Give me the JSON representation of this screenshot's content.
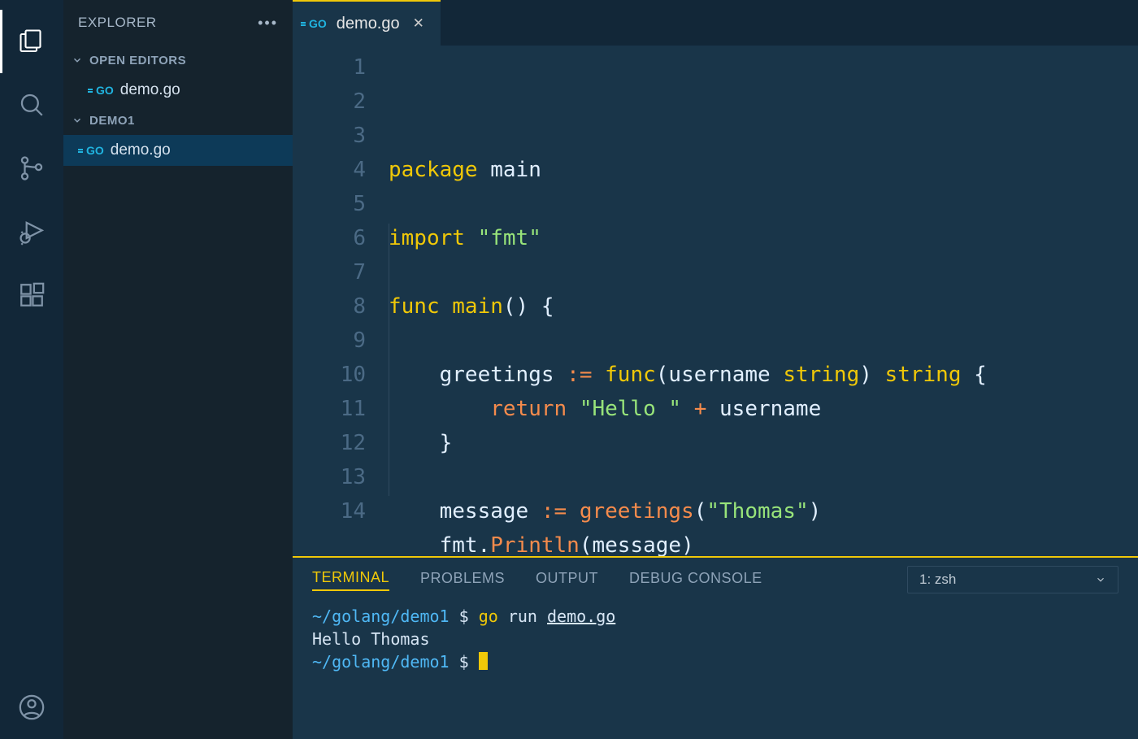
{
  "sidebar": {
    "title": "EXPLORER",
    "sections": {
      "open_editors_label": "OPEN EDITORS",
      "project_label": "DEMO1"
    },
    "open_editors": [
      {
        "name": "demo.go",
        "icon": "go"
      }
    ],
    "project_files": [
      {
        "name": "demo.go",
        "icon": "go",
        "selected": true
      }
    ]
  },
  "tabs": [
    {
      "name": "demo.go",
      "icon": "go",
      "active": true
    }
  ],
  "editor": {
    "line_numbers": [
      "1",
      "2",
      "3",
      "4",
      "5",
      "6",
      "7",
      "8",
      "9",
      "10",
      "11",
      "12",
      "13",
      "14"
    ],
    "code": [
      [
        {
          "t": "package",
          "c": "tk-kw"
        },
        {
          "t": " ",
          "c": ""
        },
        {
          "t": "main",
          "c": "tk-ident"
        }
      ],
      [],
      [
        {
          "t": "import",
          "c": "tk-kw"
        },
        {
          "t": " ",
          "c": ""
        },
        {
          "t": "\"fmt\"",
          "c": "tk-str"
        }
      ],
      [],
      [
        {
          "t": "func",
          "c": "tk-kw"
        },
        {
          "t": " ",
          "c": ""
        },
        {
          "t": "main",
          "c": "tk-func"
        },
        {
          "t": "() {",
          "c": "tk-paren"
        }
      ],
      [],
      [
        {
          "t": "    ",
          "c": ""
        },
        {
          "t": "greetings",
          "c": "tk-ident"
        },
        {
          "t": " ",
          "c": ""
        },
        {
          "t": ":=",
          "c": "tk-op"
        },
        {
          "t": " ",
          "c": ""
        },
        {
          "t": "func",
          "c": "tk-kw"
        },
        {
          "t": "(",
          "c": "tk-paren"
        },
        {
          "t": "username",
          "c": "tk-ident"
        },
        {
          "t": " ",
          "c": ""
        },
        {
          "t": "string",
          "c": "tk-type"
        },
        {
          "t": ") ",
          "c": "tk-paren"
        },
        {
          "t": "string",
          "c": "tk-type"
        },
        {
          "t": " {",
          "c": "tk-paren"
        }
      ],
      [
        {
          "t": "        ",
          "c": ""
        },
        {
          "t": "return",
          "c": "tk-return"
        },
        {
          "t": " ",
          "c": ""
        },
        {
          "t": "\"Hello \"",
          "c": "tk-str"
        },
        {
          "t": " ",
          "c": ""
        },
        {
          "t": "+",
          "c": "tk-op"
        },
        {
          "t": " ",
          "c": ""
        },
        {
          "t": "username",
          "c": "tk-ident"
        }
      ],
      [
        {
          "t": "    }",
          "c": "tk-paren"
        }
      ],
      [],
      [
        {
          "t": "    ",
          "c": ""
        },
        {
          "t": "message",
          "c": "tk-ident"
        },
        {
          "t": " ",
          "c": ""
        },
        {
          "t": ":=",
          "c": "tk-op"
        },
        {
          "t": " ",
          "c": ""
        },
        {
          "t": "greetings",
          "c": "tk-call"
        },
        {
          "t": "(",
          "c": "tk-paren"
        },
        {
          "t": "\"Thomas\"",
          "c": "tk-str"
        },
        {
          "t": ")",
          "c": "tk-paren"
        }
      ],
      [
        {
          "t": "    ",
          "c": ""
        },
        {
          "t": "fmt",
          "c": "tk-ident"
        },
        {
          "t": ".",
          "c": "tk-ident"
        },
        {
          "t": "Println",
          "c": "tk-call"
        },
        {
          "t": "(",
          "c": "tk-paren"
        },
        {
          "t": "message",
          "c": "tk-ident"
        },
        {
          "t": ")",
          "c": "tk-paren"
        }
      ],
      [
        {
          "t": "}",
          "c": "tk-paren"
        }
      ],
      []
    ]
  },
  "panel": {
    "tabs": [
      "TERMINAL",
      "PROBLEMS",
      "OUTPUT",
      "DEBUG CONSOLE"
    ],
    "active_tab": "TERMINAL",
    "terminal_selector": "1: zsh",
    "terminal": {
      "lines": [
        {
          "segments": [
            {
              "t": "~/golang/demo1",
              "c": "term-path"
            },
            {
              "t": " $ ",
              "c": "term-dollar"
            },
            {
              "t": "go",
              "c": "term-cmd"
            },
            {
              "t": " run ",
              "c": "term-out"
            },
            {
              "t": "demo.go",
              "c": "term-arg"
            }
          ]
        },
        {
          "segments": [
            {
              "t": "Hello Thomas",
              "c": "term-out"
            }
          ]
        },
        {
          "segments": [
            {
              "t": "~/golang/demo1",
              "c": "term-path"
            },
            {
              "t": " $ ",
              "c": "term-dollar"
            }
          ],
          "cursor": true
        }
      ]
    }
  }
}
